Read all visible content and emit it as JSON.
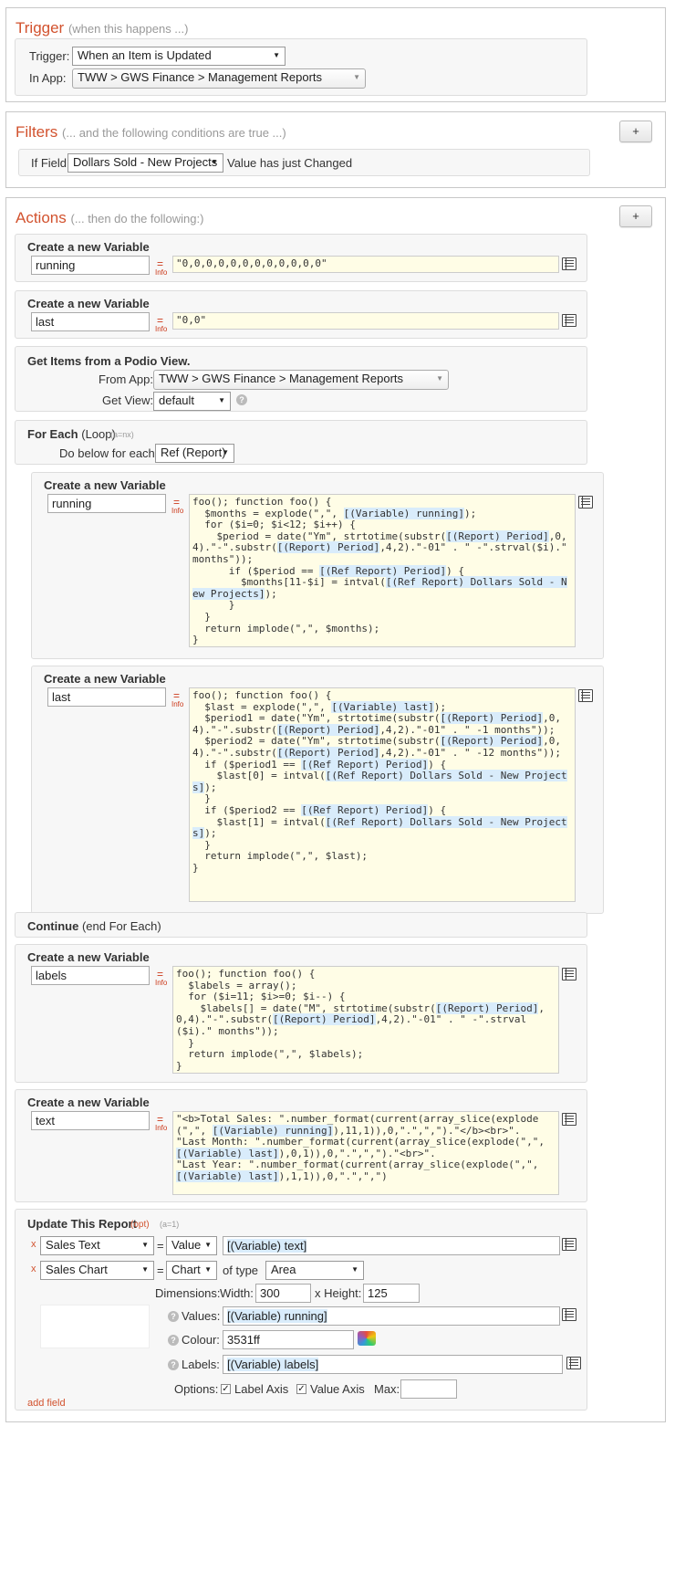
{
  "trigger": {
    "title": "Trigger",
    "subtitle": "(when this happens ...)",
    "trigger_label": "Trigger:",
    "trigger_value": "When an Item is Updated",
    "app_label": "In App:",
    "app_value": "TWW > GWS Finance > Management Reports"
  },
  "filters": {
    "title": "Filters",
    "subtitle": "(... and the following conditions are true ...)",
    "add_label": "+",
    "if_label": "If Field",
    "field_value": "Dollars Sold - New Projects",
    "condition_label": "Value has just Changed"
  },
  "actions": {
    "title": "Actions",
    "subtitle": "(... then do the following:)",
    "add_label": "+",
    "eq": "=",
    "info": "Info",
    "create_var_label": "Create a new Variable",
    "var1": {
      "name": "running",
      "value": "\"0,0,0,0,0,0,0,0,0,0,0,0\""
    },
    "var2": {
      "name": "last",
      "value": "\"0,0\""
    },
    "get_items": {
      "title": "Get Items from a Podio View.",
      "from_app_label": "From App:",
      "from_app_value": "TWW > GWS Finance > Management Reports",
      "get_view_label": "Get View:",
      "get_view_value": "default",
      "help": "?"
    },
    "foreach": {
      "title": "For Each",
      "title_suffix": "(Loop)",
      "note": "(a=nx)",
      "do_below_label": "Do below for each",
      "do_below_value": "Ref (Report)"
    },
    "var3": {
      "name": "running"
    },
    "var4": {
      "name": "last"
    },
    "continue": {
      "title": "Continue",
      "suffix": "(end For Each)"
    },
    "var5": {
      "name": "labels"
    },
    "var6": {
      "name": "text"
    },
    "update": {
      "title": "Update This Report",
      "opt": "(opt)",
      "note": "(a=1)",
      "remove": "x",
      "field1": "Sales Text",
      "mode1": "Value",
      "value1": "[(Variable) text]",
      "field2": "Sales Chart",
      "mode2": "Chart",
      "of_type_label": "of type",
      "chart_type": "Area",
      "dimensions_label": "Dimensions:",
      "width_label": "Width:",
      "width_value": "300",
      "height_label": "x Height:",
      "height_value": "125",
      "values_label": "Values:",
      "values_value": "[(Variable) running]",
      "colour_label": "Colour:",
      "colour_value": "3531ff",
      "labels_label": "Labels:",
      "labels_value": "[(Variable) labels]",
      "options_label": "Options:",
      "opt_label_axis": "Label Axis",
      "opt_value_axis": "Value Axis",
      "max_label": "Max:",
      "add_field": "add field"
    }
  }
}
